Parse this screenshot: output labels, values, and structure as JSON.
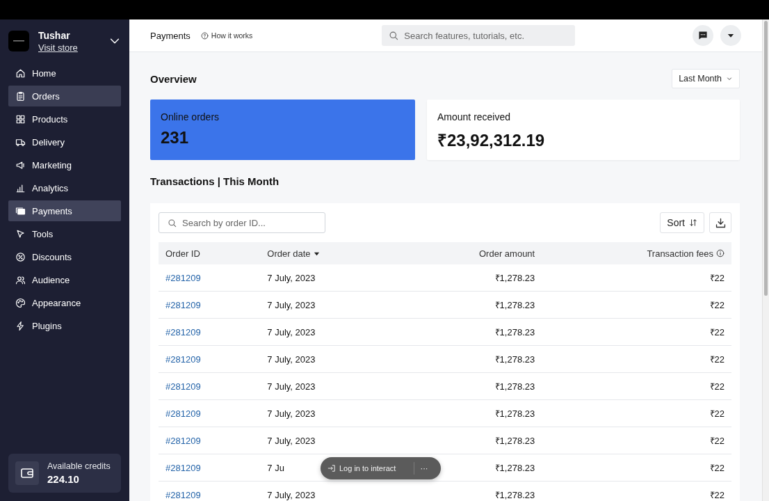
{
  "top_bar": {
    "page_title": "Payments",
    "help_link": "How it works",
    "search": {
      "placeholder": "Search features, tutorials, etc."
    }
  },
  "sidebar": {
    "store": {
      "name": "Tushar",
      "link": "Visit store"
    },
    "items": [
      {
        "label": "Home",
        "selected": false,
        "hovered": false
      },
      {
        "label": "Orders",
        "selected": false,
        "hovered": true
      },
      {
        "label": "Products",
        "selected": false,
        "hovered": false
      },
      {
        "label": "Delivery",
        "selected": false,
        "hovered": false
      },
      {
        "label": "Marketing",
        "selected": false,
        "hovered": false
      },
      {
        "label": "Analytics",
        "selected": false,
        "hovered": false
      },
      {
        "label": "Payments",
        "selected": true,
        "hovered": false
      },
      {
        "label": "Tools",
        "selected": false,
        "hovered": false
      },
      {
        "label": "Discounts",
        "selected": false,
        "hovered": false
      },
      {
        "label": "Audience",
        "selected": false,
        "hovered": false
      },
      {
        "label": "Appearance",
        "selected": false,
        "hovered": false
      },
      {
        "label": "Plugins",
        "selected": false,
        "hovered": false
      }
    ],
    "credits": {
      "label": "Available credits",
      "value": "224.10"
    }
  },
  "overview": {
    "title": "Overview",
    "period": "Last Month",
    "cards": [
      {
        "label": "Online orders",
        "value": "231",
        "highlighted": true
      },
      {
        "label": "Amount received",
        "value": "₹23,92,312.19",
        "highlighted": false
      }
    ]
  },
  "transactions": {
    "title": "Transactions | This Month",
    "search": {
      "placeholder": "Search by order ID..."
    },
    "sort_button": "Sort",
    "columns": [
      {
        "label": "Order ID",
        "sorted": false
      },
      {
        "label": "Order date",
        "sorted": true
      },
      {
        "label": "Order amount",
        "sorted": false
      },
      {
        "label": "Transaction fees",
        "sorted": false
      }
    ],
    "rows": [
      [
        "#281209",
        "7 July, 2023",
        "₹1,278.23",
        "₹22"
      ],
      [
        "#281209",
        "7 July, 2023",
        "₹1,278.23",
        "₹22"
      ],
      [
        "#281209",
        "7 July, 2023",
        "₹1,278.23",
        "₹22"
      ],
      [
        "#281209",
        "7 July, 2023",
        "₹1,278.23",
        "₹22"
      ],
      [
        "#281209",
        "7 July, 2023",
        "₹1,278.23",
        "₹22"
      ],
      [
        "#281209",
        "7 July, 2023",
        "₹1,278.23",
        "₹22"
      ],
      [
        "#281209",
        "7 July, 2023",
        "₹1,278.23",
        "₹22"
      ],
      [
        "#281209",
        "7 Ju",
        "₹1,278.23",
        "₹22"
      ],
      [
        "#281209",
        "7 July, 2023",
        "₹1,278.23",
        "₹22"
      ]
    ]
  },
  "toast": {
    "label": "Log in to interact",
    "more": "···"
  }
}
